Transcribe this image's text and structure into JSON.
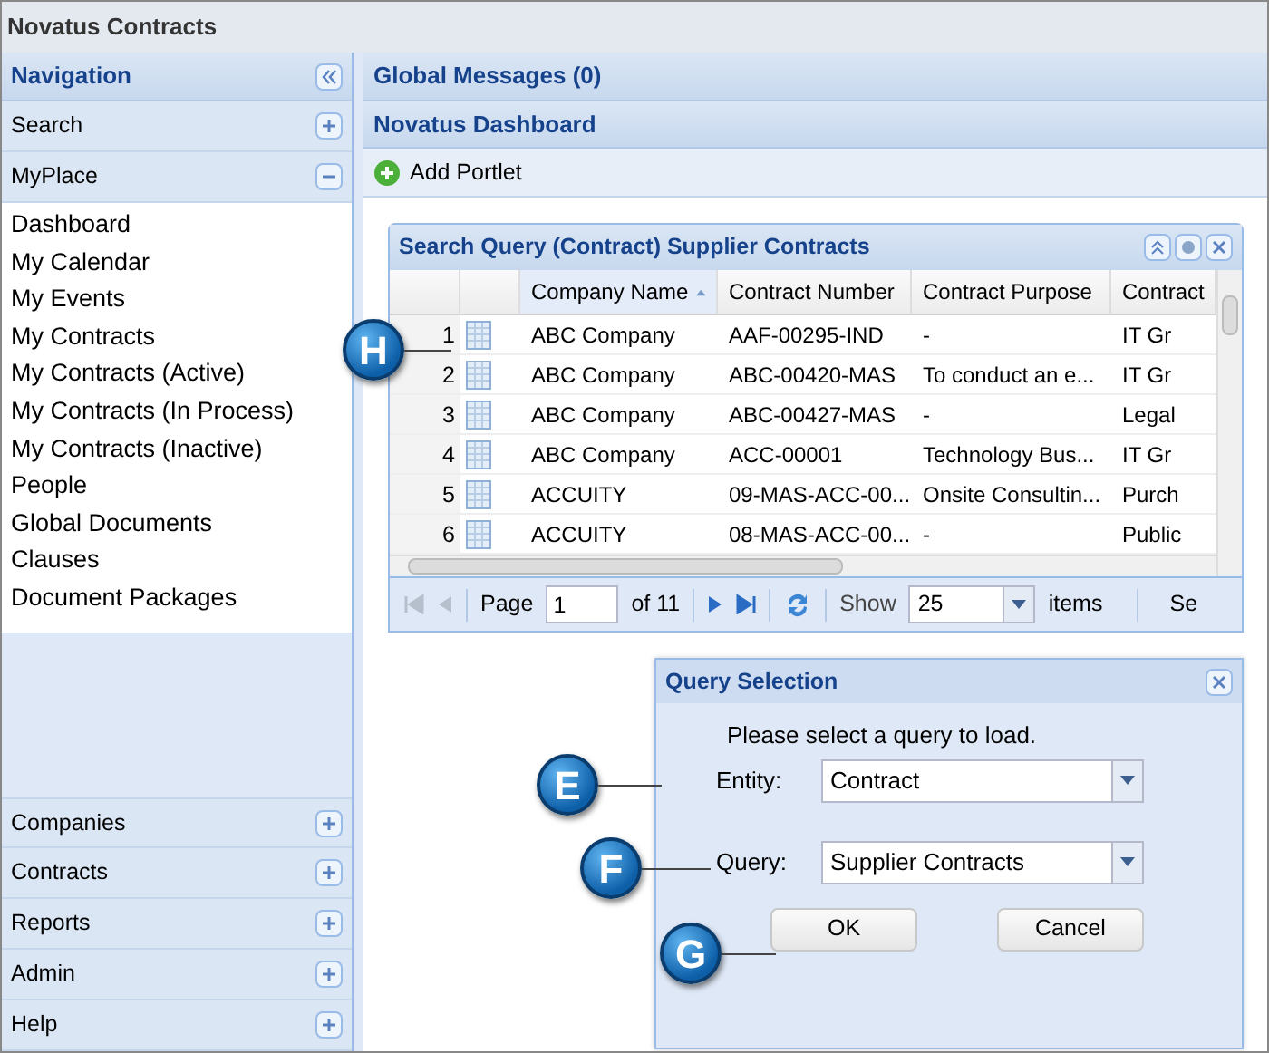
{
  "window": {
    "title": "Novatus Contracts"
  },
  "navigation": {
    "title": "Navigation",
    "sections": [
      {
        "label": "Search",
        "expanded": false
      },
      {
        "label": "MyPlace",
        "expanded": true,
        "items": [
          "Dashboard",
          "My Calendar",
          "My Events",
          "My Contracts",
          "My Contracts (Active)",
          "My Contracts (In Process)",
          "My Contracts (Inactive)",
          "People",
          "Global Documents",
          "Clauses",
          "Document Packages"
        ]
      },
      {
        "label": "Companies",
        "expanded": false
      },
      {
        "label": "Contracts",
        "expanded": false
      },
      {
        "label": "Reports",
        "expanded": false
      },
      {
        "label": "Admin",
        "expanded": false
      },
      {
        "label": "Help",
        "expanded": false
      }
    ]
  },
  "global_messages": {
    "title": "Global Messages (0)"
  },
  "dashboard": {
    "title": "Novatus Dashboard",
    "add_button": "Add Portlet"
  },
  "portlet": {
    "title": "Search Query (Contract) Supplier Contracts",
    "columns": [
      {
        "label": "Company Name",
        "sorted": true
      },
      {
        "label": "Contract Number",
        "sorted": false
      },
      {
        "label": "Contract Purpose",
        "sorted": false
      },
      {
        "label": "Contract",
        "sorted": false
      }
    ],
    "rows": [
      {
        "number": "1",
        "cells": [
          "ABC Company",
          "AAF-00295-IND",
          "-",
          "IT Gr"
        ]
      },
      {
        "number": "2",
        "cells": [
          "ABC Company",
          "ABC-00420-MAS",
          "To conduct an e...",
          "IT Gr"
        ]
      },
      {
        "number": "3",
        "cells": [
          "ABC Company",
          "ABC-00427-MAS",
          "-",
          "Legal"
        ]
      },
      {
        "number": "4",
        "cells": [
          "ABC Company",
          "ACC-00001",
          "Technology Bus...",
          "IT Gr"
        ]
      },
      {
        "number": "5",
        "cells": [
          "ACCUITY",
          "09-MAS-ACC-00...",
          "Onsite Consultin...",
          "Purch"
        ]
      },
      {
        "number": "6",
        "cells": [
          "ACCUITY",
          "08-MAS-ACC-00...",
          "-",
          "Public"
        ]
      }
    ],
    "pager": {
      "page_label": "Page",
      "page": "1",
      "of": "of 11",
      "show_label": "Show",
      "show": "25",
      "items_label": "items",
      "cut_text": "Se"
    }
  },
  "dialog": {
    "title": "Query Selection",
    "prompt": "Please select a query to load.",
    "fields": [
      {
        "label": "Entity:",
        "value": "Contract"
      },
      {
        "label": "Query:",
        "value": "Supplier Contracts"
      }
    ],
    "buttons": [
      "OK",
      "Cancel"
    ]
  },
  "callouts": [
    {
      "letter": "H"
    },
    {
      "letter": "E"
    },
    {
      "letter": "F"
    },
    {
      "letter": "G"
    }
  ]
}
